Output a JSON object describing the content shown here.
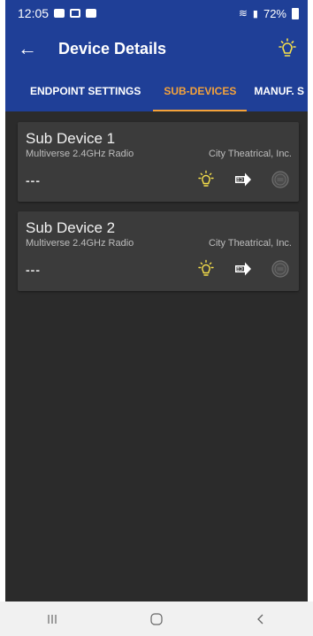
{
  "statusbar": {
    "time": "12:05",
    "battery": "72%"
  },
  "appbar": {
    "title": "Device Details",
    "back_icon": "arrow-left-icon",
    "action_icon": "identify-bulb-icon"
  },
  "tabs": [
    {
      "label": "ENDPOINT SETTINGS",
      "active": false
    },
    {
      "label": "SUB-DEVICES",
      "active": true
    },
    {
      "label": "MANUF. S",
      "active": false
    }
  ],
  "devices": [
    {
      "name": "Sub Device 1",
      "model": "Multiverse 2.4GHz Radio",
      "manufacturer": "City Theatrical, Inc.",
      "status": "---"
    },
    {
      "name": "Sub Device 2",
      "model": "Multiverse 2.4GHz Radio",
      "manufacturer": "City Theatrical, Inc.",
      "status": "---"
    }
  ],
  "colors": {
    "primary": "#1f3f97",
    "accent": "#f4a23b",
    "background": "#2b2b2b",
    "card": "#3b3b3b"
  }
}
